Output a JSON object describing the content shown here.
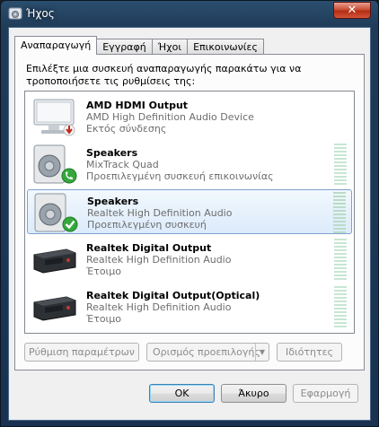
{
  "window": {
    "title": "Ήχος",
    "close_label": "✕"
  },
  "tabs": [
    {
      "label": "Αναπαραγωγή",
      "active": true
    },
    {
      "label": "Εγγραφή",
      "active": false
    },
    {
      "label": "Ήχοι",
      "active": false
    },
    {
      "label": "Επικοινωνίες",
      "active": false
    }
  ],
  "playback": {
    "instructions": "Επιλέξτε μια συσκευή αναπαραγωγής παρακάτω για να τροποποιήσετε τις ρυθμίσεις της:",
    "devices": [
      {
        "name": "AMD HDMI Output",
        "description": "AMD High Definition Audio Device",
        "status": "Εκτός σύνδεσης",
        "icon": "monitor-icon",
        "badge": "disconnected-arrow-icon",
        "meter": false,
        "selected": false
      },
      {
        "name": "Speakers",
        "description": "MixTrack Quad",
        "status": "Προεπιλεγμένη συσκευή επικοινωνίας",
        "icon": "speaker-icon",
        "badge": "phone-badge-icon",
        "meter": true,
        "selected": false
      },
      {
        "name": "Speakers",
        "description": "Realtek High Definition Audio",
        "status": "Προεπιλεγμένη συσκευή",
        "icon": "speaker-icon",
        "badge": "checkmark-badge-icon",
        "meter": true,
        "selected": true
      },
      {
        "name": "Realtek Digital Output",
        "description": "Realtek High Definition Audio",
        "status": "Έτοιμο",
        "icon": "digital-output-icon",
        "badge": "",
        "meter": true,
        "selected": false
      },
      {
        "name": "Realtek Digital Output(Optical)",
        "description": "Realtek High Definition Audio",
        "status": "Έτοιμο",
        "icon": "digital-output-icon",
        "badge": "",
        "meter": true,
        "selected": false
      }
    ],
    "buttons": {
      "configure": "Ρύθμιση παραμέτρων",
      "set_default": "Ορισμός προεπιλογής",
      "properties": "Ιδιότητες"
    }
  },
  "dialog_buttons": {
    "ok": "OK",
    "cancel": "Άκυρο",
    "apply": "Εφαρμογή"
  },
  "colors": {
    "selection_border": "#7da2ce",
    "meter": "#c7e6d3",
    "close_button": "#c7472d"
  }
}
